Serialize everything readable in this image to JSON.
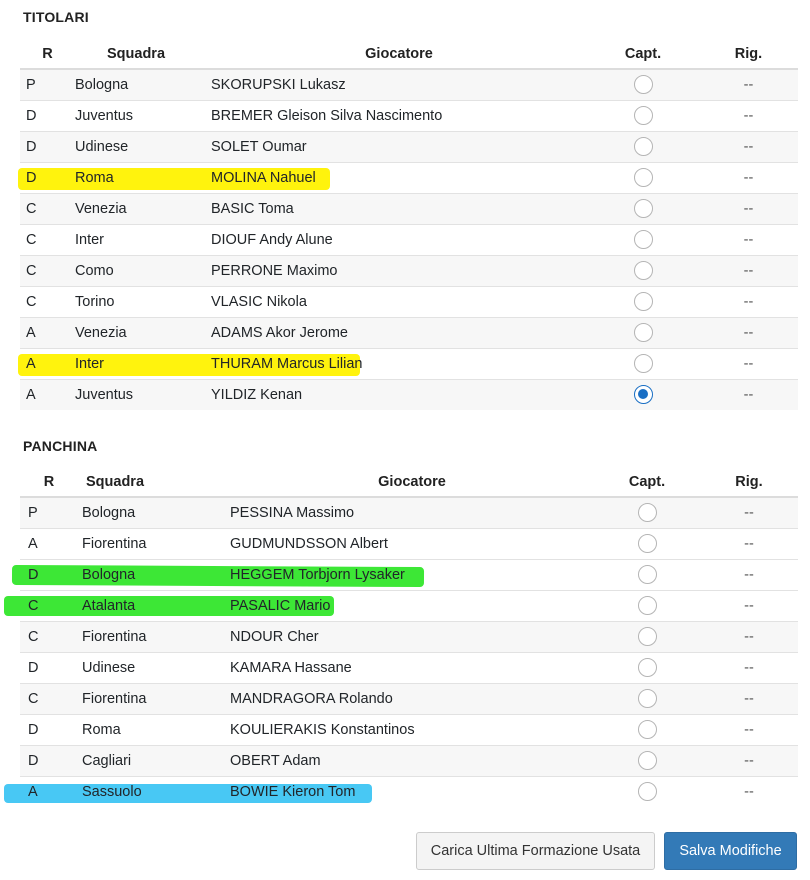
{
  "titolari": {
    "title": "TITOLARI",
    "headers": {
      "r": "R",
      "squadra": "Squadra",
      "giocatore": "Giocatore",
      "capt": "Capt.",
      "rig": "Rig."
    },
    "rows": [
      {
        "r": "P",
        "squadra": "Bologna",
        "giocatore": "SKORUPSKI Lukasz",
        "rig": "--",
        "captain": false,
        "highlight": ""
      },
      {
        "r": "D",
        "squadra": "Juventus",
        "giocatore": "BREMER Gleison Silva Nascimento",
        "rig": "--",
        "captain": false,
        "highlight": ""
      },
      {
        "r": "D",
        "squadra": "Udinese",
        "giocatore": "SOLET Oumar",
        "rig": "--",
        "captain": false,
        "highlight": ""
      },
      {
        "r": "D",
        "squadra": "Roma",
        "giocatore": "MOLINA Nahuel",
        "rig": "--",
        "captain": false,
        "highlight": "yellow"
      },
      {
        "r": "C",
        "squadra": "Venezia",
        "giocatore": "BASIC Toma",
        "rig": "--",
        "captain": false,
        "highlight": ""
      },
      {
        "r": "C",
        "squadra": "Inter",
        "giocatore": "DIOUF Andy Alune",
        "rig": "--",
        "captain": false,
        "highlight": ""
      },
      {
        "r": "C",
        "squadra": "Como",
        "giocatore": "PERRONE Maximo",
        "rig": "--",
        "captain": false,
        "highlight": ""
      },
      {
        "r": "C",
        "squadra": "Torino",
        "giocatore": "VLASIC Nikola",
        "rig": "--",
        "captain": false,
        "highlight": ""
      },
      {
        "r": "A",
        "squadra": "Venezia",
        "giocatore": "ADAMS Akor Jerome",
        "rig": "--",
        "captain": false,
        "highlight": ""
      },
      {
        "r": "A",
        "squadra": "Inter",
        "giocatore": "THURAM Marcus Lilian",
        "rig": "--",
        "captain": false,
        "highlight": "yellow"
      },
      {
        "r": "A",
        "squadra": "Juventus",
        "giocatore": "YILDIZ Kenan",
        "rig": "--",
        "captain": true,
        "highlight": ""
      }
    ]
  },
  "panchina": {
    "title": "PANCHINA",
    "headers": {
      "r": "R",
      "squadra": "Squadra",
      "giocatore": "Giocatore",
      "capt": "Capt.",
      "rig": "Rig."
    },
    "rows": [
      {
        "r": "P",
        "squadra": "Bologna",
        "giocatore": "PESSINA Massimo",
        "rig": "--",
        "captain": false,
        "highlight": ""
      },
      {
        "r": "A",
        "squadra": "Fiorentina",
        "giocatore": "GUDMUNDSSON Albert",
        "rig": "--",
        "captain": false,
        "highlight": ""
      },
      {
        "r": "D",
        "squadra": "Bologna",
        "giocatore": "HEGGEM Torbjorn Lysaker",
        "rig": "--",
        "captain": false,
        "highlight": "green"
      },
      {
        "r": "C",
        "squadra": "Atalanta",
        "giocatore": "PASALIC Mario",
        "rig": "--",
        "captain": false,
        "highlight": "green"
      },
      {
        "r": "C",
        "squadra": "Fiorentina",
        "giocatore": "NDOUR Cher",
        "rig": "--",
        "captain": false,
        "highlight": ""
      },
      {
        "r": "D",
        "squadra": "Udinese",
        "giocatore": "KAMARA Hassane",
        "rig": "--",
        "captain": false,
        "highlight": ""
      },
      {
        "r": "C",
        "squadra": "Fiorentina",
        "giocatore": "MANDRAGORA Rolando",
        "rig": "--",
        "captain": false,
        "highlight": ""
      },
      {
        "r": "D",
        "squadra": "Roma",
        "giocatore": "KOULIERAKIS Konstantinos",
        "rig": "--",
        "captain": false,
        "highlight": ""
      },
      {
        "r": "D",
        "squadra": "Cagliari",
        "giocatore": "OBERT Adam",
        "rig": "--",
        "captain": false,
        "highlight": ""
      },
      {
        "r": "A",
        "squadra": "Sassuolo",
        "giocatore": "BOWIE Kieron Tom",
        "rig": "--",
        "captain": false,
        "highlight": "blue"
      }
    ]
  },
  "buttons": {
    "load_last": "Carica Ultima Formazione Usata",
    "save": "Salva Modifiche"
  },
  "colors": {
    "highlight_yellow": "#fff200",
    "highlight_green": "#33e62b",
    "highlight_blue": "#3ec5f3",
    "primary": "#337ab7"
  }
}
